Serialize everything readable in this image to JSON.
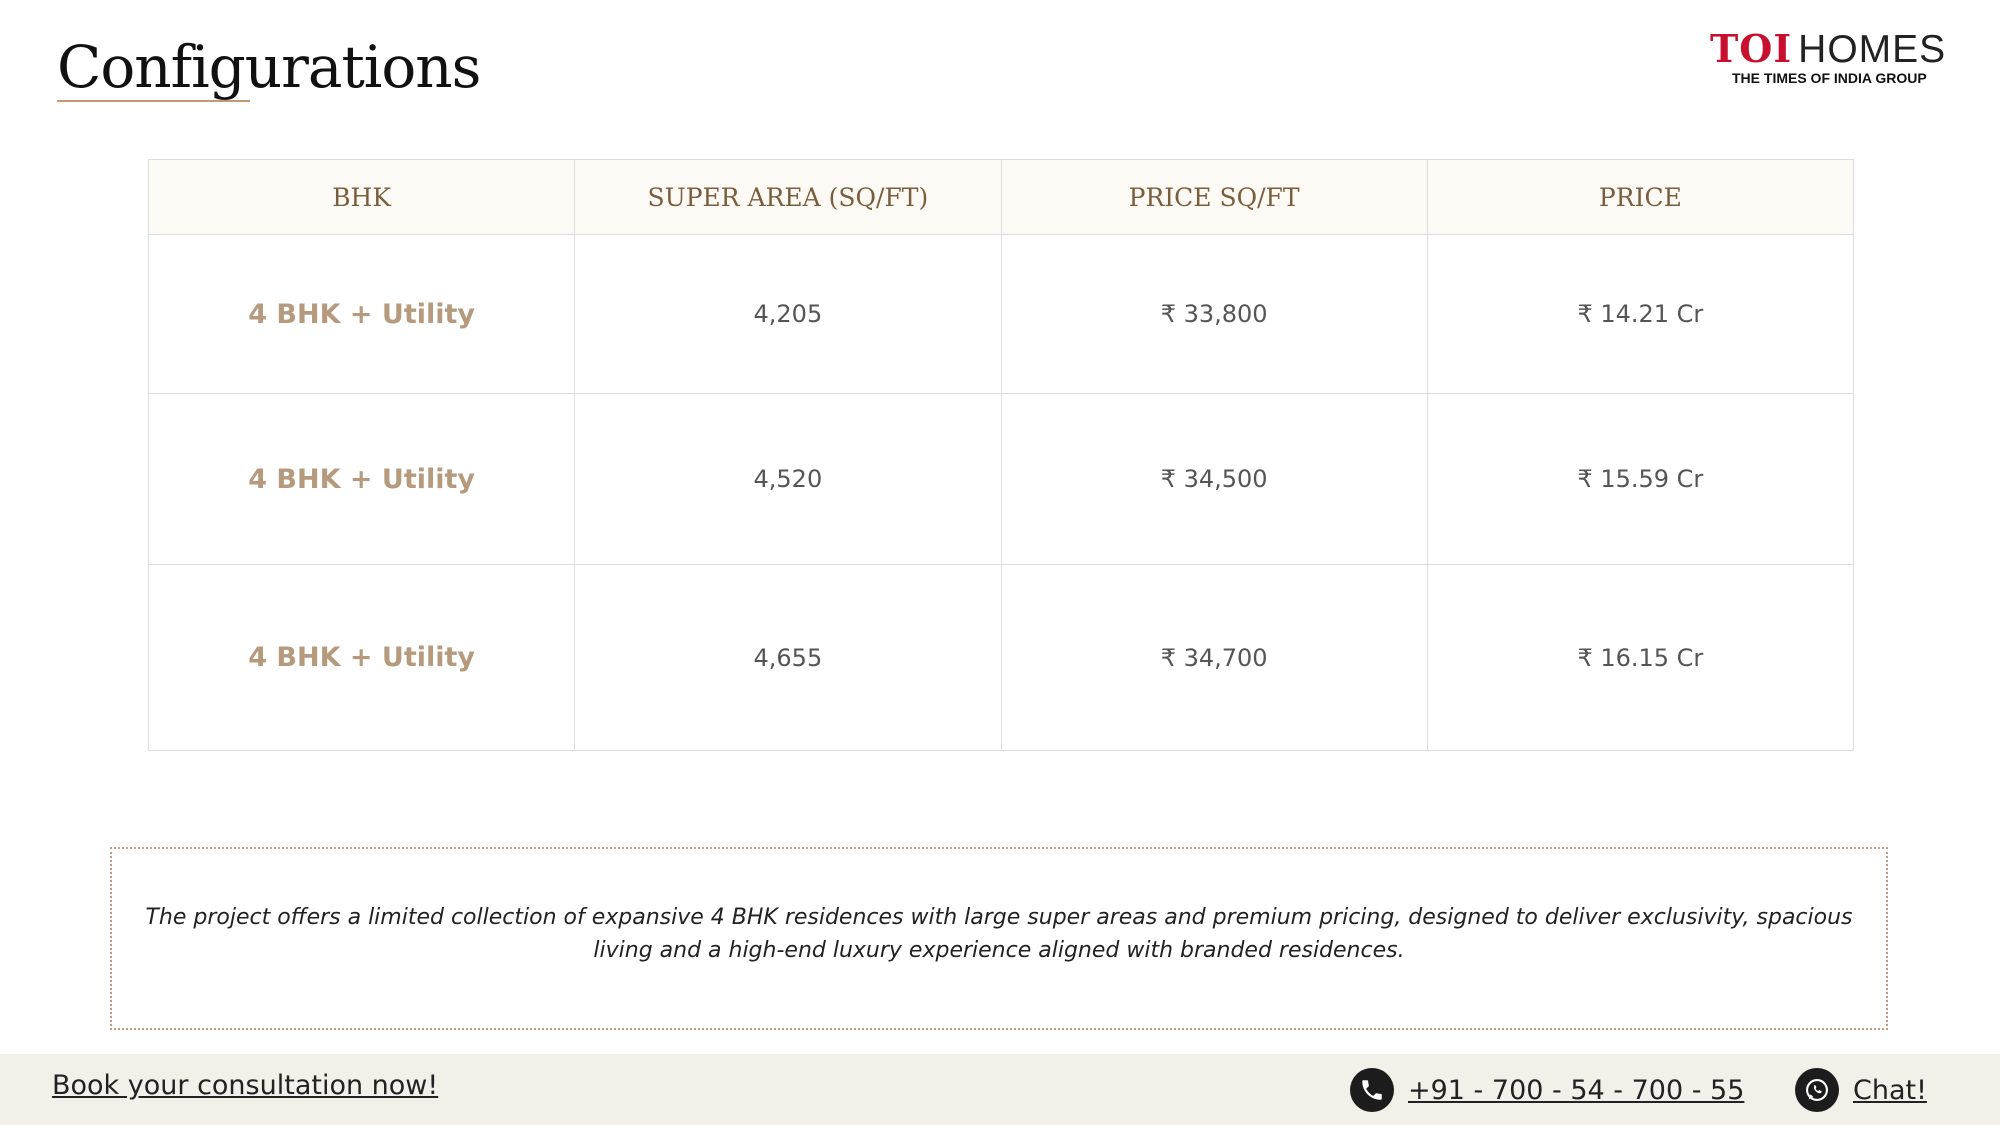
{
  "header": {
    "title": "Configurations",
    "logo_brand": "TOI",
    "logo_product": "HOMES",
    "logo_tagline": "THE TIMES OF INDIA GROUP"
  },
  "table": {
    "columns": [
      "BHK",
      "SUPER AREA (SQ/FT)",
      "PRICE SQ/FT",
      "PRICE"
    ],
    "rows": [
      {
        "bhk": "4 BHK + Utility",
        "super_area": "4,205",
        "price_sqft": "₹ 33,800",
        "price": "₹ 14.21 Cr"
      },
      {
        "bhk": "4 BHK + Utility",
        "super_area": "4,520",
        "price_sqft": "₹ 34,500",
        "price": "₹ 15.59 Cr"
      },
      {
        "bhk": "4 BHK + Utility",
        "super_area": "4,655",
        "price_sqft": "₹ 34,700",
        "price": "₹ 16.15 Cr"
      }
    ]
  },
  "note": {
    "text": "The project offers a limited collection of expansive 4 BHK residences with large super areas and premium pricing, designed to deliver exclusivity, spacious living and a high-end luxury experience aligned with branded residences."
  },
  "footer": {
    "cta_label": "Book your consultation now!",
    "phone": "+91 - 700 - 54 - 700 - 55",
    "chat_label": "Chat!",
    "phone_icon": "phone-icon",
    "chat_icon": "whatsapp-icon"
  },
  "colors": {
    "accent": "#c29a75",
    "brand_red": "#c8102e",
    "header_text": "#7a5e3c",
    "bhk_text": "#b59a7e",
    "footer_bg": "#f3efe9"
  }
}
